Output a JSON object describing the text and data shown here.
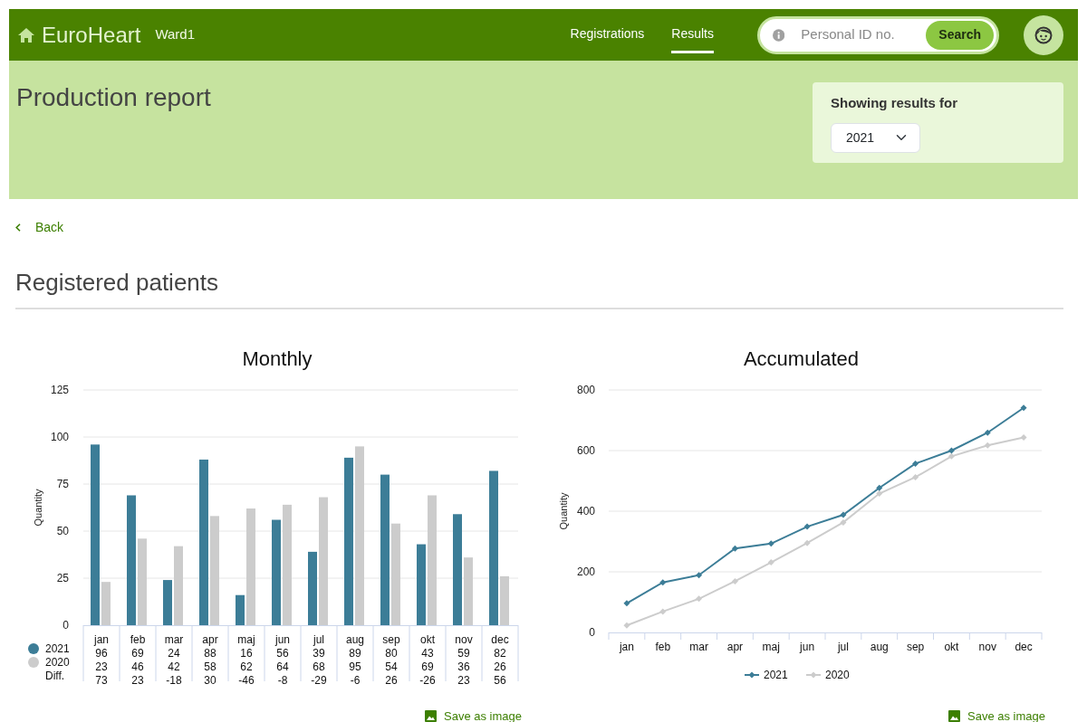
{
  "navbar": {
    "brand": "EuroHeart",
    "ward": "Ward1",
    "links": [
      {
        "label": "Registrations",
        "selected": false
      },
      {
        "label": "Results",
        "selected": true
      }
    ],
    "search": {
      "placeholder": "Personal ID no.",
      "button": "Search"
    }
  },
  "header": {
    "title": "Production report",
    "filter": {
      "label": "Showing results for",
      "value": "2021"
    }
  },
  "back": "Back",
  "section_title": "Registered patients",
  "charts": [
    {
      "chart_data": {
        "type": "bar",
        "title": "Monthly",
        "ylabel": "Quantity",
        "grid": true,
        "legend": "bottom-left",
        "categories": [
          "jan",
          "feb",
          "mar",
          "apr",
          "maj",
          "jun",
          "jul",
          "aug",
          "sep",
          "okt",
          "nov",
          "dec"
        ],
        "ylim": [
          0,
          125
        ],
        "yticks": [
          0,
          25,
          50,
          75,
          100,
          125
        ],
        "series": [
          {
            "name": "2021",
            "color": "#3c7d97",
            "values": [
              96,
              69,
              24,
              88,
              16,
              56,
              39,
              89,
              80,
              43,
              59,
              82
            ]
          },
          {
            "name": "2020",
            "color": "#cccccc",
            "values": [
              23,
              46,
              42,
              58,
              62,
              64,
              68,
              95,
              54,
              69,
              36,
              26
            ]
          }
        ]
      },
      "table": {
        "diff_label": "Diff.",
        "rows": [
          [
            "96",
            "69",
            "24",
            "88",
            "16",
            "56",
            "39",
            "89",
            "80",
            "43",
            "59",
            "82"
          ],
          [
            "23",
            "46",
            "42",
            "58",
            "62",
            "64",
            "68",
            "95",
            "54",
            "69",
            "36",
            "26"
          ],
          [
            "73",
            "23",
            "-18",
            "30",
            "-46",
            "-8",
            "-29",
            "-6",
            "26",
            "-26",
            "23",
            "56"
          ]
        ]
      },
      "save": "Save as image"
    },
    {
      "chart_data": {
        "type": "line",
        "title": "Accumulated",
        "ylabel": "Quantity",
        "grid": true,
        "legend": "bottom",
        "categories": [
          "jan",
          "feb",
          "mar",
          "apr",
          "maj",
          "jun",
          "jul",
          "aug",
          "sep",
          "okt",
          "nov",
          "dec"
        ],
        "ylim": [
          0,
          800
        ],
        "yticks": [
          0,
          200,
          400,
          600,
          800
        ],
        "series": [
          {
            "name": "2021",
            "color": "#3c7d97",
            "marker": "diamond",
            "values": [
              96,
              165,
              189,
              277,
              293,
              349,
              388,
              477,
              557,
              600,
              659,
              741
            ]
          },
          {
            "name": "2020",
            "color": "#cccccc",
            "marker": "diamond",
            "values": [
              23,
              69,
              111,
              169,
              231,
              295,
              363,
              458,
              512,
              581,
              617,
              643
            ]
          }
        ]
      },
      "save": "Save as image"
    }
  ]
}
